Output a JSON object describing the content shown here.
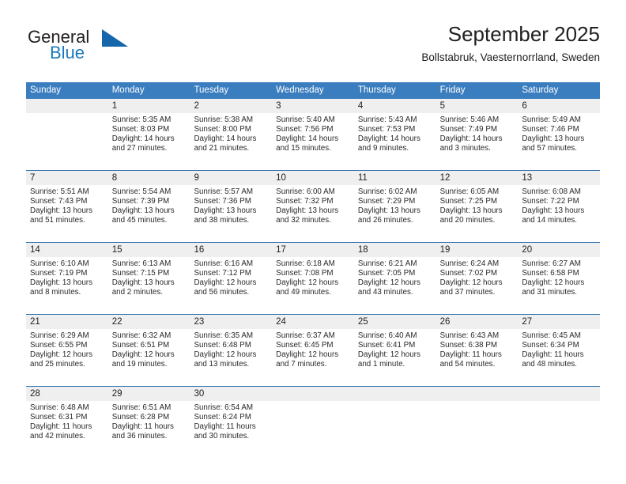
{
  "brand": {
    "name_part1": "General",
    "name_part2": "Blue",
    "triangle_icon": "triangle-logo-icon"
  },
  "header": {
    "title": "September 2025",
    "location": "Bollstabruk, Vaesternorrland, Sweden"
  },
  "colors": {
    "header_blue": "#3b7ec0",
    "row_divider_blue": "#2f6fad",
    "daynum_band_gray": "#efefef",
    "brand_blue": "#1878be",
    "brand_triangle": "#1566ab"
  },
  "weekdays": [
    "Sunday",
    "Monday",
    "Tuesday",
    "Wednesday",
    "Thursday",
    "Friday",
    "Saturday"
  ],
  "weeks": [
    [
      {
        "day": "",
        "sunrise": "",
        "sunset": "",
        "daylight1": "",
        "daylight2": ""
      },
      {
        "day": "1",
        "sunrise": "Sunrise: 5:35 AM",
        "sunset": "Sunset: 8:03 PM",
        "daylight1": "Daylight: 14 hours",
        "daylight2": "and 27 minutes."
      },
      {
        "day": "2",
        "sunrise": "Sunrise: 5:38 AM",
        "sunset": "Sunset: 8:00 PM",
        "daylight1": "Daylight: 14 hours",
        "daylight2": "and 21 minutes."
      },
      {
        "day": "3",
        "sunrise": "Sunrise: 5:40 AM",
        "sunset": "Sunset: 7:56 PM",
        "daylight1": "Daylight: 14 hours",
        "daylight2": "and 15 minutes."
      },
      {
        "day": "4",
        "sunrise": "Sunrise: 5:43 AM",
        "sunset": "Sunset: 7:53 PM",
        "daylight1": "Daylight: 14 hours",
        "daylight2": "and 9 minutes."
      },
      {
        "day": "5",
        "sunrise": "Sunrise: 5:46 AM",
        "sunset": "Sunset: 7:49 PM",
        "daylight1": "Daylight: 14 hours",
        "daylight2": "and 3 minutes."
      },
      {
        "day": "6",
        "sunrise": "Sunrise: 5:49 AM",
        "sunset": "Sunset: 7:46 PM",
        "daylight1": "Daylight: 13 hours",
        "daylight2": "and 57 minutes."
      }
    ],
    [
      {
        "day": "7",
        "sunrise": "Sunrise: 5:51 AM",
        "sunset": "Sunset: 7:43 PM",
        "daylight1": "Daylight: 13 hours",
        "daylight2": "and 51 minutes."
      },
      {
        "day": "8",
        "sunrise": "Sunrise: 5:54 AM",
        "sunset": "Sunset: 7:39 PM",
        "daylight1": "Daylight: 13 hours",
        "daylight2": "and 45 minutes."
      },
      {
        "day": "9",
        "sunrise": "Sunrise: 5:57 AM",
        "sunset": "Sunset: 7:36 PM",
        "daylight1": "Daylight: 13 hours",
        "daylight2": "and 38 minutes."
      },
      {
        "day": "10",
        "sunrise": "Sunrise: 6:00 AM",
        "sunset": "Sunset: 7:32 PM",
        "daylight1": "Daylight: 13 hours",
        "daylight2": "and 32 minutes."
      },
      {
        "day": "11",
        "sunrise": "Sunrise: 6:02 AM",
        "sunset": "Sunset: 7:29 PM",
        "daylight1": "Daylight: 13 hours",
        "daylight2": "and 26 minutes."
      },
      {
        "day": "12",
        "sunrise": "Sunrise: 6:05 AM",
        "sunset": "Sunset: 7:25 PM",
        "daylight1": "Daylight: 13 hours",
        "daylight2": "and 20 minutes."
      },
      {
        "day": "13",
        "sunrise": "Sunrise: 6:08 AM",
        "sunset": "Sunset: 7:22 PM",
        "daylight1": "Daylight: 13 hours",
        "daylight2": "and 14 minutes."
      }
    ],
    [
      {
        "day": "14",
        "sunrise": "Sunrise: 6:10 AM",
        "sunset": "Sunset: 7:19 PM",
        "daylight1": "Daylight: 13 hours",
        "daylight2": "and 8 minutes."
      },
      {
        "day": "15",
        "sunrise": "Sunrise: 6:13 AM",
        "sunset": "Sunset: 7:15 PM",
        "daylight1": "Daylight: 13 hours",
        "daylight2": "and 2 minutes."
      },
      {
        "day": "16",
        "sunrise": "Sunrise: 6:16 AM",
        "sunset": "Sunset: 7:12 PM",
        "daylight1": "Daylight: 12 hours",
        "daylight2": "and 56 minutes."
      },
      {
        "day": "17",
        "sunrise": "Sunrise: 6:18 AM",
        "sunset": "Sunset: 7:08 PM",
        "daylight1": "Daylight: 12 hours",
        "daylight2": "and 49 minutes."
      },
      {
        "day": "18",
        "sunrise": "Sunrise: 6:21 AM",
        "sunset": "Sunset: 7:05 PM",
        "daylight1": "Daylight: 12 hours",
        "daylight2": "and 43 minutes."
      },
      {
        "day": "19",
        "sunrise": "Sunrise: 6:24 AM",
        "sunset": "Sunset: 7:02 PM",
        "daylight1": "Daylight: 12 hours",
        "daylight2": "and 37 minutes."
      },
      {
        "day": "20",
        "sunrise": "Sunrise: 6:27 AM",
        "sunset": "Sunset: 6:58 PM",
        "daylight1": "Daylight: 12 hours",
        "daylight2": "and 31 minutes."
      }
    ],
    [
      {
        "day": "21",
        "sunrise": "Sunrise: 6:29 AM",
        "sunset": "Sunset: 6:55 PM",
        "daylight1": "Daylight: 12 hours",
        "daylight2": "and 25 minutes."
      },
      {
        "day": "22",
        "sunrise": "Sunrise: 6:32 AM",
        "sunset": "Sunset: 6:51 PM",
        "daylight1": "Daylight: 12 hours",
        "daylight2": "and 19 minutes."
      },
      {
        "day": "23",
        "sunrise": "Sunrise: 6:35 AM",
        "sunset": "Sunset: 6:48 PM",
        "daylight1": "Daylight: 12 hours",
        "daylight2": "and 13 minutes."
      },
      {
        "day": "24",
        "sunrise": "Sunrise: 6:37 AM",
        "sunset": "Sunset: 6:45 PM",
        "daylight1": "Daylight: 12 hours",
        "daylight2": "and 7 minutes."
      },
      {
        "day": "25",
        "sunrise": "Sunrise: 6:40 AM",
        "sunset": "Sunset: 6:41 PM",
        "daylight1": "Daylight: 12 hours",
        "daylight2": "and 1 minute."
      },
      {
        "day": "26",
        "sunrise": "Sunrise: 6:43 AM",
        "sunset": "Sunset: 6:38 PM",
        "daylight1": "Daylight: 11 hours",
        "daylight2": "and 54 minutes."
      },
      {
        "day": "27",
        "sunrise": "Sunrise: 6:45 AM",
        "sunset": "Sunset: 6:34 PM",
        "daylight1": "Daylight: 11 hours",
        "daylight2": "and 48 minutes."
      }
    ],
    [
      {
        "day": "28",
        "sunrise": "Sunrise: 6:48 AM",
        "sunset": "Sunset: 6:31 PM",
        "daylight1": "Daylight: 11 hours",
        "daylight2": "and 42 minutes."
      },
      {
        "day": "29",
        "sunrise": "Sunrise: 6:51 AM",
        "sunset": "Sunset: 6:28 PM",
        "daylight1": "Daylight: 11 hours",
        "daylight2": "and 36 minutes."
      },
      {
        "day": "30",
        "sunrise": "Sunrise: 6:54 AM",
        "sunset": "Sunset: 6:24 PM",
        "daylight1": "Daylight: 11 hours",
        "daylight2": "and 30 minutes."
      },
      {
        "day": "",
        "sunrise": "",
        "sunset": "",
        "daylight1": "",
        "daylight2": ""
      },
      {
        "day": "",
        "sunrise": "",
        "sunset": "",
        "daylight1": "",
        "daylight2": ""
      },
      {
        "day": "",
        "sunrise": "",
        "sunset": "",
        "daylight1": "",
        "daylight2": ""
      },
      {
        "day": "",
        "sunrise": "",
        "sunset": "",
        "daylight1": "",
        "daylight2": ""
      }
    ]
  ]
}
